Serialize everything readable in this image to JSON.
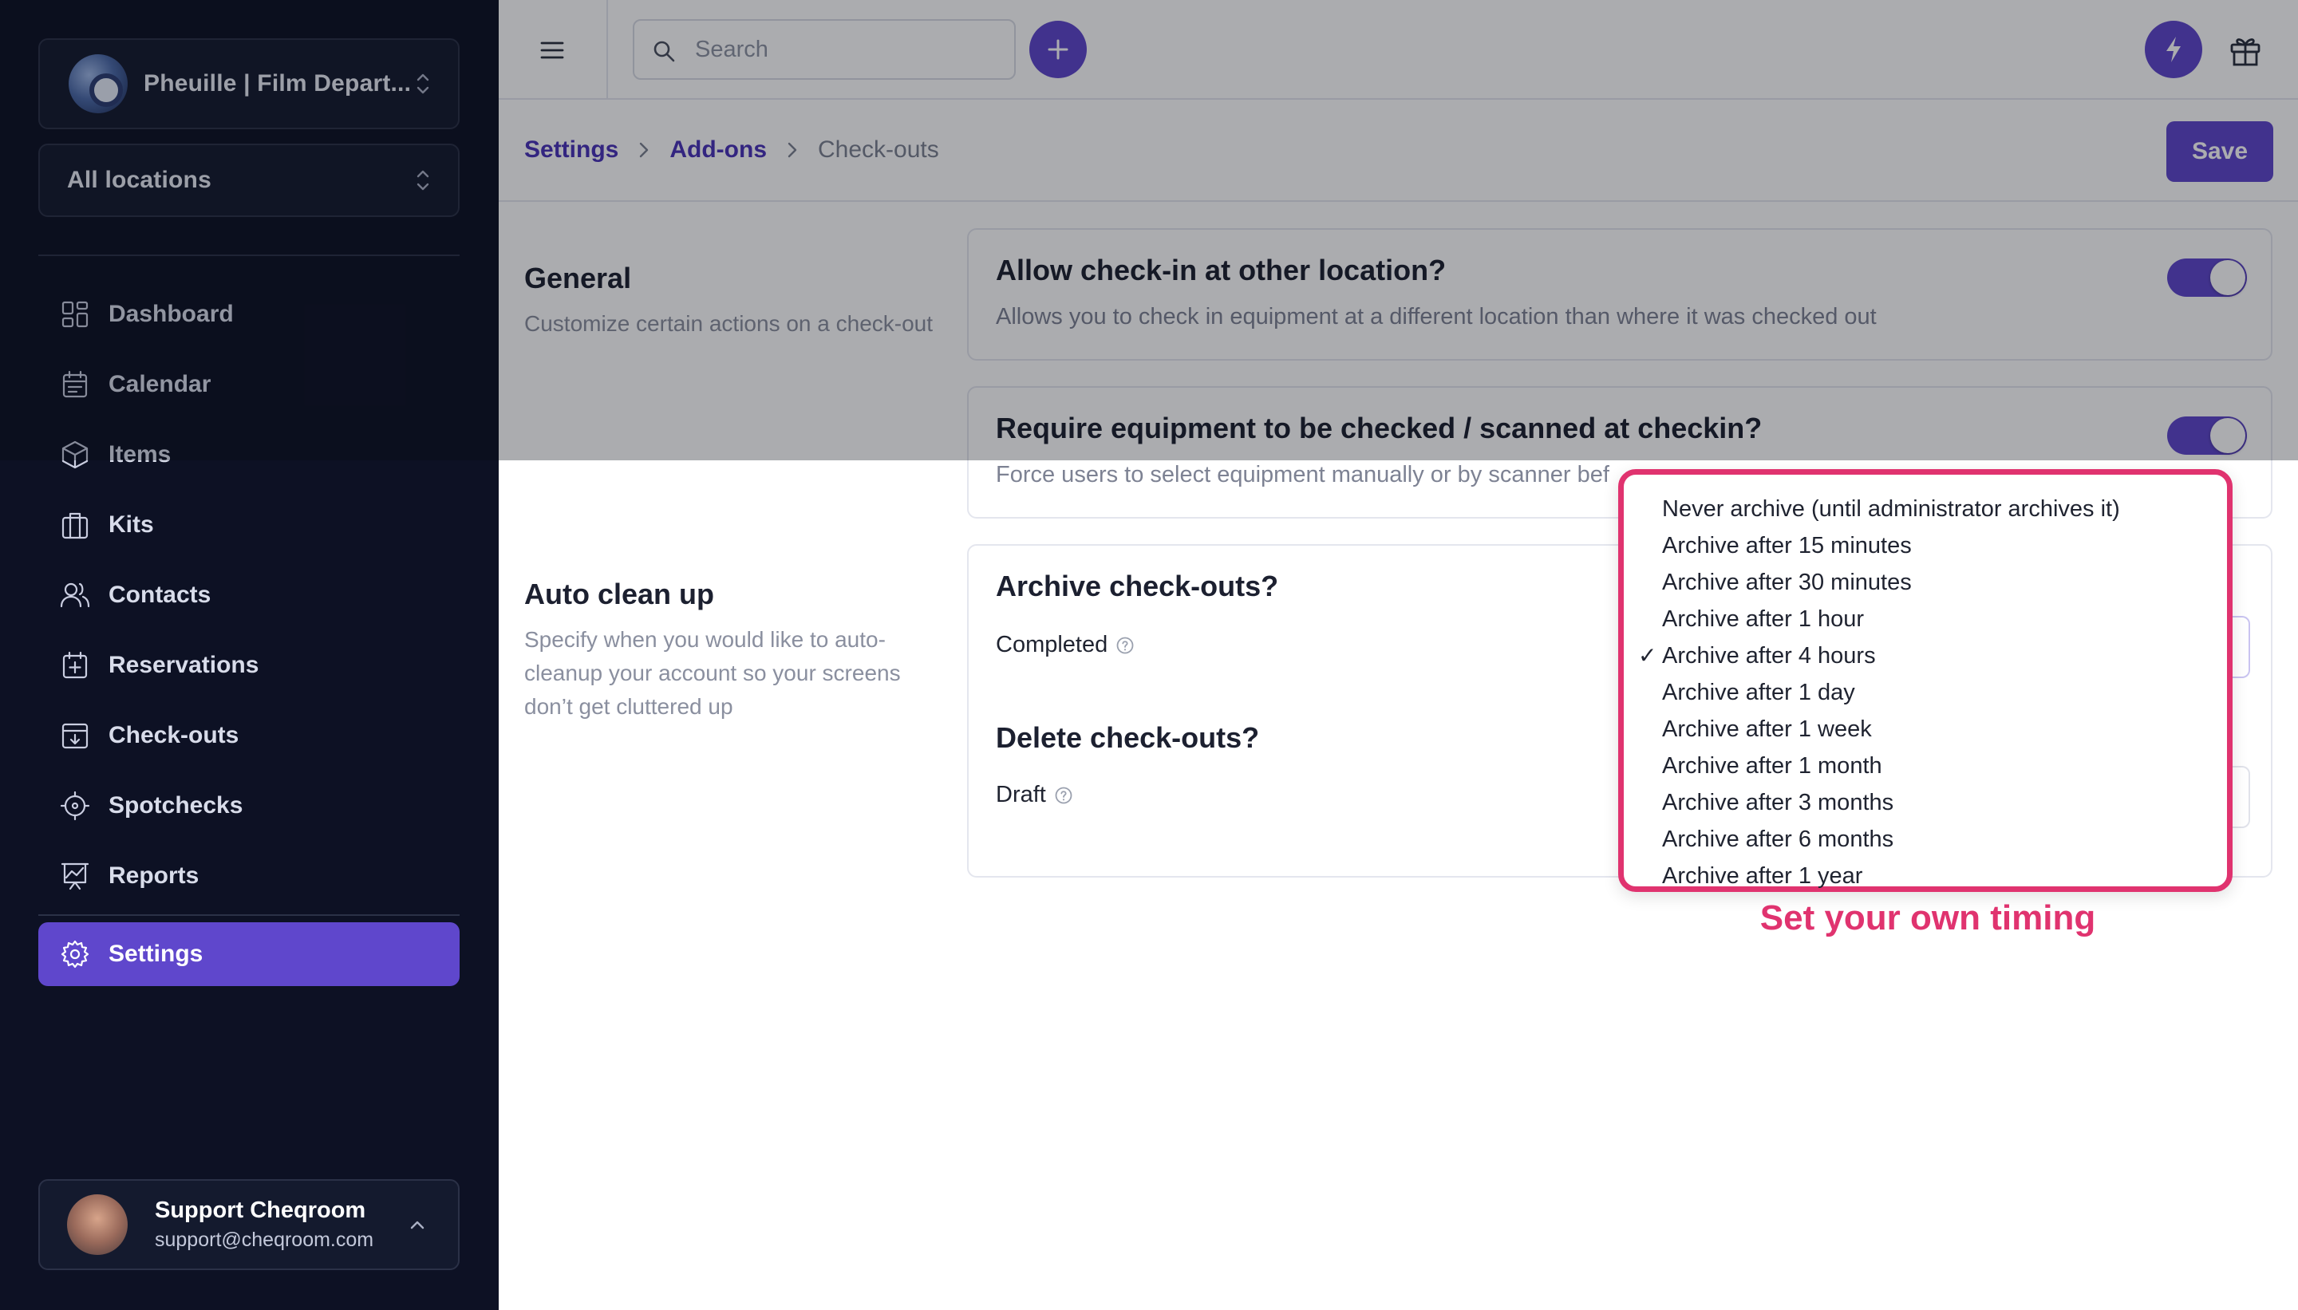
{
  "sidebar": {
    "org_name": "Pheuille | Film Depart...",
    "location": "All locations",
    "nav": [
      {
        "label": "Dashboard",
        "icon": "dashboard-icon"
      },
      {
        "label": "Calendar",
        "icon": "calendar-icon"
      },
      {
        "label": "Items",
        "icon": "box-icon"
      },
      {
        "label": "Kits",
        "icon": "suitcase-icon"
      },
      {
        "label": "Contacts",
        "icon": "users-icon"
      },
      {
        "label": "Reservations",
        "icon": "calendar-plus-icon"
      },
      {
        "label": "Check-outs",
        "icon": "archive-box-icon"
      },
      {
        "label": "Spotchecks",
        "icon": "crosshair-icon"
      },
      {
        "label": "Reports",
        "icon": "chart-board-icon"
      },
      {
        "label": "Settings",
        "icon": "gear-icon",
        "active": true
      }
    ],
    "user": {
      "name": "Support Cheqroom",
      "email": "support@cheqroom.com"
    }
  },
  "topbar": {
    "search_placeholder": "Search"
  },
  "breadcrumb": {
    "items": [
      "Settings",
      "Add-ons",
      "Check-outs"
    ]
  },
  "save_label": "Save",
  "general": {
    "title": "General",
    "description": "Customize certain actions on a check-out",
    "cards": [
      {
        "title": "Allow check-in at other location?",
        "description": "Allows you to check in equipment at a different location than where it was checked out",
        "enabled": true
      },
      {
        "title": "Require equipment to be checked / scanned at checkin?",
        "description": "Force users to select equipment manually or by scanner bef",
        "enabled": true
      }
    ]
  },
  "auto_clean": {
    "title": "Auto clean up",
    "description": "Specify when you would like to auto-cleanup your account so your screens don’t get cluttered up",
    "archive": {
      "title": "Archive check-outs?",
      "field": "Completed"
    },
    "delete": {
      "title": "Delete check-outs?",
      "field": "Draft"
    }
  },
  "dropdown": {
    "options": [
      "Never archive (until administrator archives it)",
      "Archive after 15 minutes",
      "Archive after 30 minutes",
      "Archive after 1 hour",
      "Archive after 4 hours",
      "Archive after 1 day",
      "Archive after 1 week",
      "Archive after 1 month",
      "Archive after 3 months",
      "Archive after 6 months",
      "Archive after 1 year"
    ],
    "selected": "Archive after 4 hours",
    "check_mark": "✓"
  },
  "annotation": "Set your own timing",
  "colors": {
    "accent": "#5f47cc",
    "sidebar_bg": "#0d1124",
    "highlight": "#e0336f"
  }
}
